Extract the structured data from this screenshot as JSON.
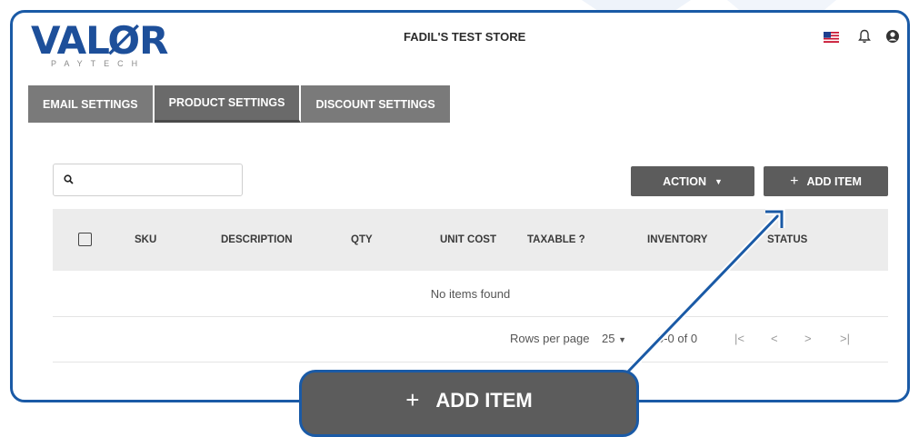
{
  "header": {
    "logo_text": "VALØR",
    "logo_sub": "PAYTECH",
    "store_name": "FADIL'S TEST STORE",
    "icons": [
      "us-flag-icon",
      "bell-icon",
      "user-icon"
    ]
  },
  "tabs": [
    {
      "label": "EMAIL SETTINGS"
    },
    {
      "label": "PRODUCT SETTINGS"
    },
    {
      "label": "DISCOUNT SETTINGS"
    }
  ],
  "toolbar": {
    "search_placeholder": "",
    "action_label": "ACTION",
    "add_item_label": "ADD ITEM"
  },
  "table": {
    "columns": [
      "SKU",
      "DESCRIPTION",
      "QTY",
      "UNIT COST",
      "TAXABLE ?",
      "INVENTORY",
      "STATUS"
    ],
    "empty_message": "No items found"
  },
  "pagination": {
    "rows_per_page_label": "Rows per page",
    "rows_per_page_value": "25",
    "range_text": "0-0 of 0",
    "first_icon": "|<",
    "prev_icon": "<",
    "next_icon": ">",
    "last_icon": ">|"
  },
  "callout": {
    "label": "ADD ITEM"
  },
  "colors": {
    "frame_border": "#1a5aa6",
    "button_bg": "#5c5c5c",
    "tab_bg": "#7a7a7a",
    "header_row_bg": "#ececec"
  }
}
